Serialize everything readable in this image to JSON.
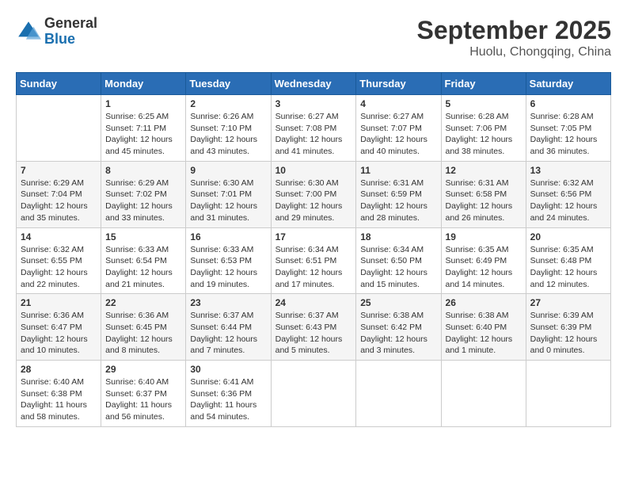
{
  "header": {
    "logo_general": "General",
    "logo_blue": "Blue",
    "month_title": "September 2025",
    "location": "Huolu, Chongqing, China"
  },
  "days_of_week": [
    "Sunday",
    "Monday",
    "Tuesday",
    "Wednesday",
    "Thursday",
    "Friday",
    "Saturday"
  ],
  "weeks": [
    [
      {
        "day": "",
        "info": ""
      },
      {
        "day": "1",
        "info": "Sunrise: 6:25 AM\nSunset: 7:11 PM\nDaylight: 12 hours\nand 45 minutes."
      },
      {
        "day": "2",
        "info": "Sunrise: 6:26 AM\nSunset: 7:10 PM\nDaylight: 12 hours\nand 43 minutes."
      },
      {
        "day": "3",
        "info": "Sunrise: 6:27 AM\nSunset: 7:08 PM\nDaylight: 12 hours\nand 41 minutes."
      },
      {
        "day": "4",
        "info": "Sunrise: 6:27 AM\nSunset: 7:07 PM\nDaylight: 12 hours\nand 40 minutes."
      },
      {
        "day": "5",
        "info": "Sunrise: 6:28 AM\nSunset: 7:06 PM\nDaylight: 12 hours\nand 38 minutes."
      },
      {
        "day": "6",
        "info": "Sunrise: 6:28 AM\nSunset: 7:05 PM\nDaylight: 12 hours\nand 36 minutes."
      }
    ],
    [
      {
        "day": "7",
        "info": "Sunrise: 6:29 AM\nSunset: 7:04 PM\nDaylight: 12 hours\nand 35 minutes."
      },
      {
        "day": "8",
        "info": "Sunrise: 6:29 AM\nSunset: 7:02 PM\nDaylight: 12 hours\nand 33 minutes."
      },
      {
        "day": "9",
        "info": "Sunrise: 6:30 AM\nSunset: 7:01 PM\nDaylight: 12 hours\nand 31 minutes."
      },
      {
        "day": "10",
        "info": "Sunrise: 6:30 AM\nSunset: 7:00 PM\nDaylight: 12 hours\nand 29 minutes."
      },
      {
        "day": "11",
        "info": "Sunrise: 6:31 AM\nSunset: 6:59 PM\nDaylight: 12 hours\nand 28 minutes."
      },
      {
        "day": "12",
        "info": "Sunrise: 6:31 AM\nSunset: 6:58 PM\nDaylight: 12 hours\nand 26 minutes."
      },
      {
        "day": "13",
        "info": "Sunrise: 6:32 AM\nSunset: 6:56 PM\nDaylight: 12 hours\nand 24 minutes."
      }
    ],
    [
      {
        "day": "14",
        "info": "Sunrise: 6:32 AM\nSunset: 6:55 PM\nDaylight: 12 hours\nand 22 minutes."
      },
      {
        "day": "15",
        "info": "Sunrise: 6:33 AM\nSunset: 6:54 PM\nDaylight: 12 hours\nand 21 minutes."
      },
      {
        "day": "16",
        "info": "Sunrise: 6:33 AM\nSunset: 6:53 PM\nDaylight: 12 hours\nand 19 minutes."
      },
      {
        "day": "17",
        "info": "Sunrise: 6:34 AM\nSunset: 6:51 PM\nDaylight: 12 hours\nand 17 minutes."
      },
      {
        "day": "18",
        "info": "Sunrise: 6:34 AM\nSunset: 6:50 PM\nDaylight: 12 hours\nand 15 minutes."
      },
      {
        "day": "19",
        "info": "Sunrise: 6:35 AM\nSunset: 6:49 PM\nDaylight: 12 hours\nand 14 minutes."
      },
      {
        "day": "20",
        "info": "Sunrise: 6:35 AM\nSunset: 6:48 PM\nDaylight: 12 hours\nand 12 minutes."
      }
    ],
    [
      {
        "day": "21",
        "info": "Sunrise: 6:36 AM\nSunset: 6:47 PM\nDaylight: 12 hours\nand 10 minutes."
      },
      {
        "day": "22",
        "info": "Sunrise: 6:36 AM\nSunset: 6:45 PM\nDaylight: 12 hours\nand 8 minutes."
      },
      {
        "day": "23",
        "info": "Sunrise: 6:37 AM\nSunset: 6:44 PM\nDaylight: 12 hours\nand 7 minutes."
      },
      {
        "day": "24",
        "info": "Sunrise: 6:37 AM\nSunset: 6:43 PM\nDaylight: 12 hours\nand 5 minutes."
      },
      {
        "day": "25",
        "info": "Sunrise: 6:38 AM\nSunset: 6:42 PM\nDaylight: 12 hours\nand 3 minutes."
      },
      {
        "day": "26",
        "info": "Sunrise: 6:38 AM\nSunset: 6:40 PM\nDaylight: 12 hours\nand 1 minute."
      },
      {
        "day": "27",
        "info": "Sunrise: 6:39 AM\nSunset: 6:39 PM\nDaylight: 12 hours\nand 0 minutes."
      }
    ],
    [
      {
        "day": "28",
        "info": "Sunrise: 6:40 AM\nSunset: 6:38 PM\nDaylight: 11 hours\nand 58 minutes."
      },
      {
        "day": "29",
        "info": "Sunrise: 6:40 AM\nSunset: 6:37 PM\nDaylight: 11 hours\nand 56 minutes."
      },
      {
        "day": "30",
        "info": "Sunrise: 6:41 AM\nSunset: 6:36 PM\nDaylight: 11 hours\nand 54 minutes."
      },
      {
        "day": "",
        "info": ""
      },
      {
        "day": "",
        "info": ""
      },
      {
        "day": "",
        "info": ""
      },
      {
        "day": "",
        "info": ""
      }
    ]
  ]
}
